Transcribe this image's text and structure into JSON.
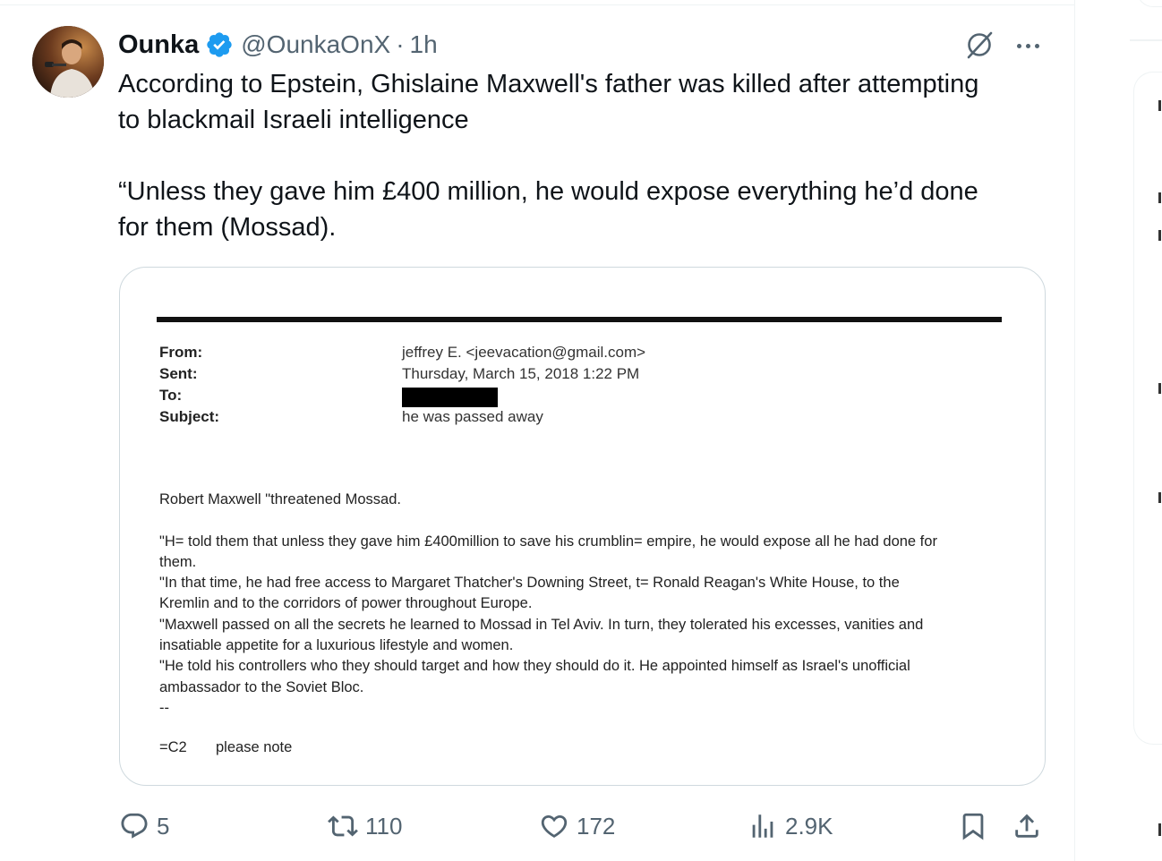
{
  "tweet": {
    "author": {
      "display_name": "Ounka",
      "handle": "@OunkaOnX",
      "separator": "·",
      "time": "1h",
      "verified": true
    },
    "text_paragraphs": [
      "According to Epstein, Ghislaine Maxwell's father was killed after attempting\nto blackmail Israeli intelligence",
      "“Unless they gave him £400 million, he would expose everything he’d done\nfor them (Mossad)."
    ],
    "media": {
      "email": {
        "header_rows": [
          {
            "label": "From:",
            "value": "jeffrey E. <jeevacation@gmail.com>"
          },
          {
            "label": "Sent:",
            "value": "Thursday, March 15, 2018 1:22 PM"
          },
          {
            "label": "To:",
            "value": ""
          },
          {
            "label": "Subject:",
            "value": "he was passed away"
          }
        ],
        "body_lines": [
          "Robert Maxwell \"threatened Mossad.",
          "",
          "\"H= told them that unless they gave him £400million to save his crumblin= empire, he would expose all he had done for",
          "them.",
          "\"In that time, he had free access to Margaret Thatcher's Downing Street, t= Ronald Reagan's White House, to the",
          "Kremlin and to the corridors of power throughout Europe.",
          "\"Maxwell passed on all the secrets he learned to Mossad in Tel Aviv. In turn, they tolerated his excesses, vanities and",
          "insatiable appetite for a luxurious lifestyle and women.",
          "\"He told his controllers who they should target and how they should do it. He appointed himself as Israel's unofficial",
          "ambassador to the Soviet Bloc.",
          "--"
        ],
        "signature": {
          "tag": "=C2",
          "text": "please note"
        }
      }
    },
    "actions": {
      "replies": "5",
      "reposts": "110",
      "likes": "172",
      "views": "2.9K"
    }
  },
  "colors": {
    "verified_badge": "#1d9bf0",
    "secondary_text": "#536471",
    "border": "#cfd9de"
  },
  "icons": [
    "verified-badge-icon",
    "grok-icon",
    "more-icon",
    "reply-icon",
    "repost-icon",
    "like-icon",
    "views-icon",
    "bookmark-icon",
    "share-icon"
  ]
}
